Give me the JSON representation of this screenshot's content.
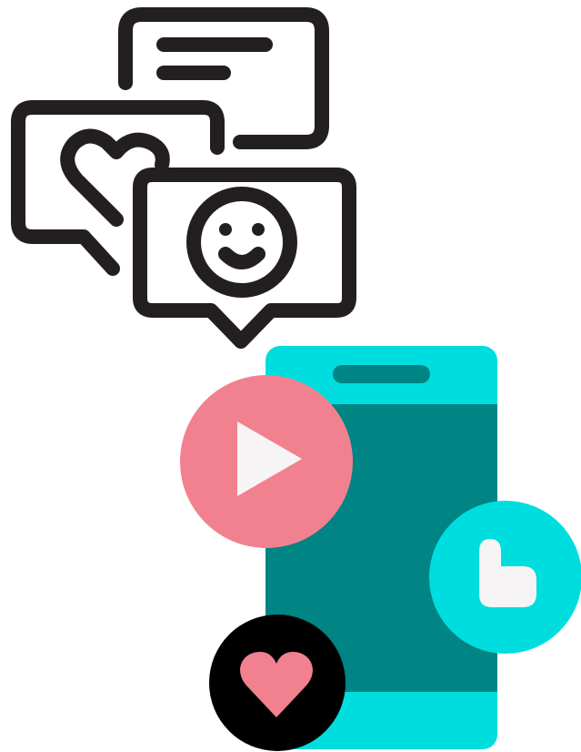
{
  "illustration": {
    "icons": [
      "message-lines-bubble-icon",
      "heart-bubble-icon",
      "smiley-bubble-icon",
      "smartphone-icon",
      "play-icon",
      "thumbs-up-icon",
      "heart-icon"
    ]
  },
  "colors": {
    "outline": "#231F20",
    "phone_frame": "#00DDDF",
    "phone_screen": "#008484",
    "phone_speaker": "#008484",
    "play_badge": "#F28190",
    "play_symbol": "#F7F4F6",
    "like_badge": "#00DDDF",
    "like_symbol": "#F7F4F6",
    "heart_badge": "#000000",
    "heart_symbol": "#F28190",
    "background": "#FFFFFF"
  }
}
